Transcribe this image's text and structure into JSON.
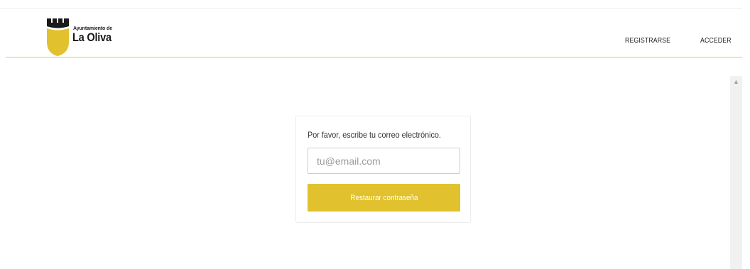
{
  "header": {
    "logo": {
      "subtitle": "Ayuntamiento de",
      "title": "La Oliva",
      "icon": "castle-shield-logo"
    },
    "nav": {
      "register": "REGISTRARSE",
      "login": "ACCEDER"
    }
  },
  "form": {
    "prompt": "Por favor, escribe tu correo electrónico.",
    "email_placeholder": "tu@email.com",
    "email_value": "",
    "submit_label": "Restaurar contraseña"
  },
  "scrollbar": {
    "up_icon": "chevron-up-icon"
  },
  "colors": {
    "accent": "#e2c12e",
    "header_line": "#e6c84a",
    "logo_dark": "#1a1a1a",
    "logo_yellow": "#e2c12e"
  }
}
